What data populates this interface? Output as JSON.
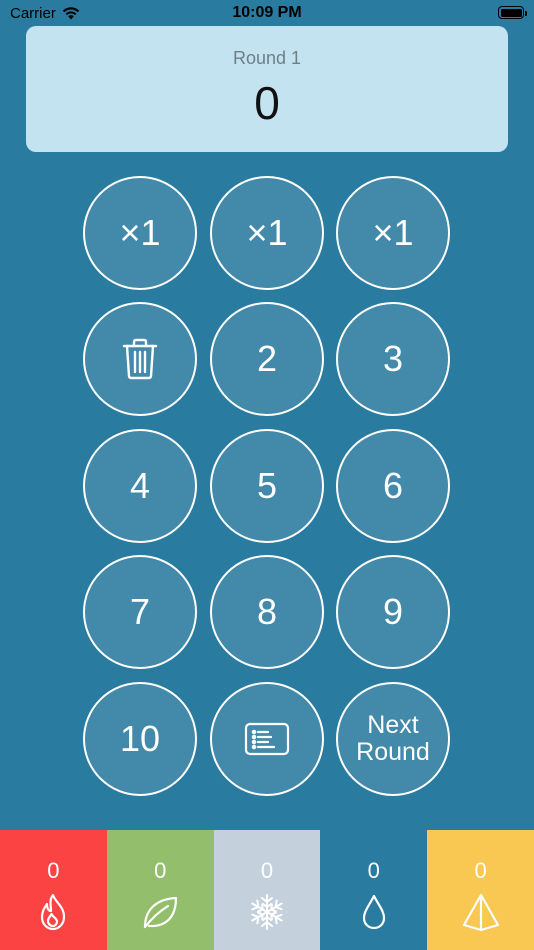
{
  "status_bar": {
    "carrier": "Carrier",
    "time": "10:09 PM",
    "battery_level": 1.0
  },
  "score_card": {
    "round_label": "Round 1",
    "score": "0"
  },
  "keypad": {
    "multipliers": [
      "×1",
      "×1",
      "×1"
    ],
    "digits": [
      "2",
      "3",
      "4",
      "5",
      "6",
      "7",
      "8",
      "9",
      "10"
    ],
    "next_round_line1": "Next",
    "next_round_line2": "Round",
    "delete_icon": "trash-icon",
    "log_icon": "score-list-icon"
  },
  "elements": [
    {
      "name": "fire",
      "icon": "flame-icon",
      "count": "0",
      "color": "#fa4342"
    },
    {
      "name": "leaf",
      "icon": "leaf-icon",
      "count": "0",
      "color": "#93bf6d"
    },
    {
      "name": "ice",
      "icon": "snowflake-icon",
      "count": "0",
      "color": "#c4d0dc"
    },
    {
      "name": "water",
      "icon": "droplet-icon",
      "count": "0",
      "color": "#2a7ba0"
    },
    {
      "name": "crystal",
      "icon": "pyramid-icon",
      "count": "0",
      "color": "#f8c852"
    }
  ],
  "colors": {
    "background": "#2a7ba0",
    "key_fill": "#4289aa",
    "score_card": "#c3e3f1"
  }
}
